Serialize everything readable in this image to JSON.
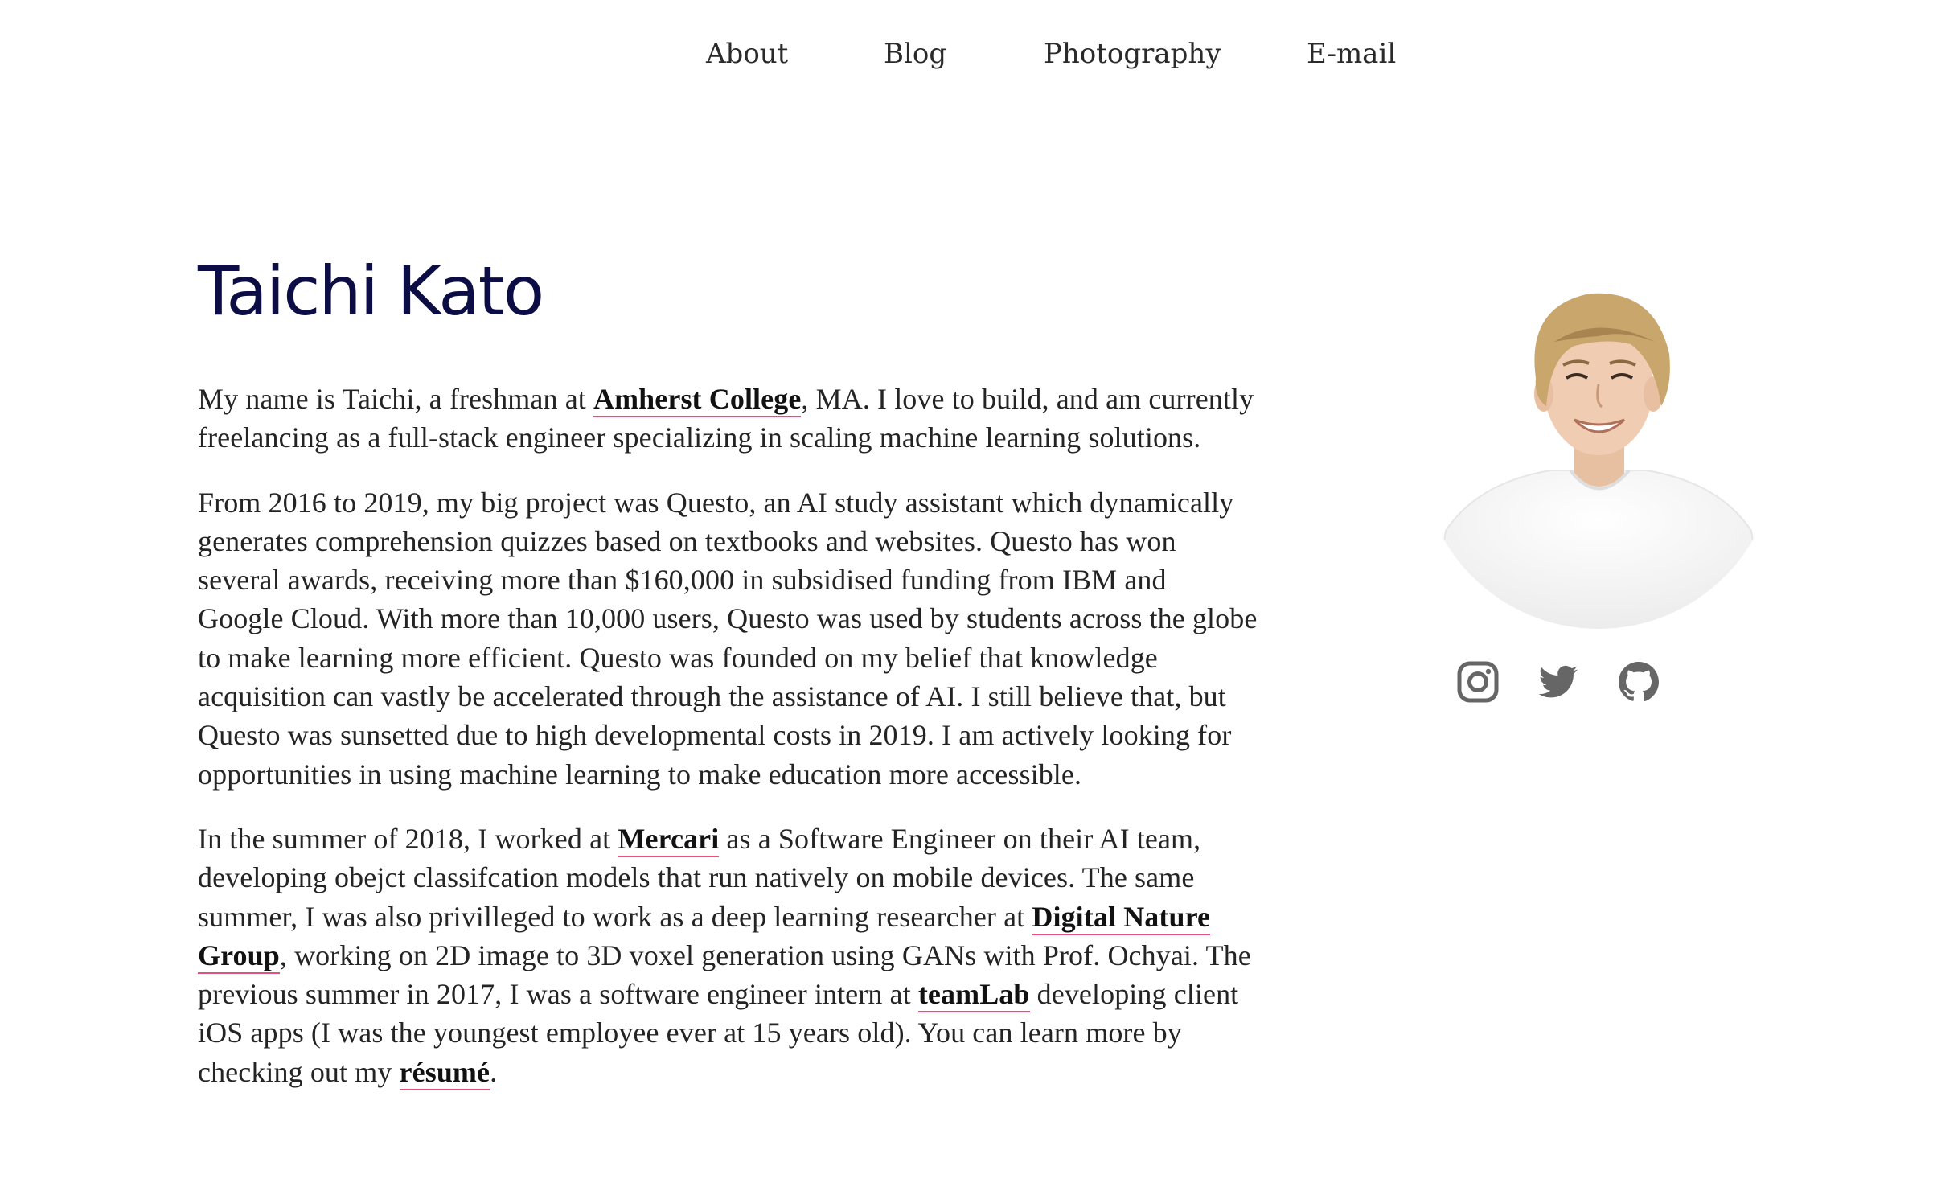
{
  "nav": {
    "items": [
      {
        "label": "About"
      },
      {
        "label": "Blog"
      },
      {
        "label": "Photography"
      },
      {
        "label": "E-mail"
      }
    ]
  },
  "profile": {
    "name": "Taichi Kato",
    "photo_icon": "portrait-photo"
  },
  "bio": {
    "p1": {
      "t1": "My name is Taichi, a freshman at ",
      "link1": "Amherst College",
      "t2": ", MA. I love to build, and am currently freelancing as a full-stack engineer specializing in scaling machine learning solutions."
    },
    "p2": {
      "text": "From 2016 to 2019, my big project was Questo, an AI study assistant which dynamically generates comprehension quizzes based on textbooks and websites. Questo has won several awards, receiving more than $160,000 in subsidised funding from IBM and Google Cloud. With more than 10,000 users, Questo was used by students across the globe to make learning more efficient. Questo was founded on my belief that knowledge acquisition can vastly be accelerated through the assistance of AI. I still believe that, but Questo was sunsetted due to high developmental costs in 2019. I am actively looking for opportunities in using machine learning to make education more accessible."
    },
    "p3": {
      "t1": "In the summer of 2018, I worked at ",
      "link1": "Mercari",
      "t2": " as a Software Engineer on their AI team, developing obejct classifcation models that run natively on mobile devices. The same summer, I was also privilleged to work as a deep learning researcher at ",
      "link2": "Digital Nature Group",
      "t3": ", working on 2D image to 3D voxel generation using GANs with Prof. Ochyai. The previous summer in 2017, I was a software engineer intern at ",
      "link3": "teamLab",
      "t4": " developing client iOS apps (I was the youngest employee ever at 15 years old). You can learn more by checking out my ",
      "link4": "résumé",
      "t5": "."
    }
  },
  "social": [
    {
      "icon": "instagram-icon"
    },
    {
      "icon": "twitter-icon"
    },
    {
      "icon": "github-icon"
    }
  ],
  "colors": {
    "title": "#0d0d45",
    "link_underline": "#e8507a",
    "icon": "#666666"
  }
}
